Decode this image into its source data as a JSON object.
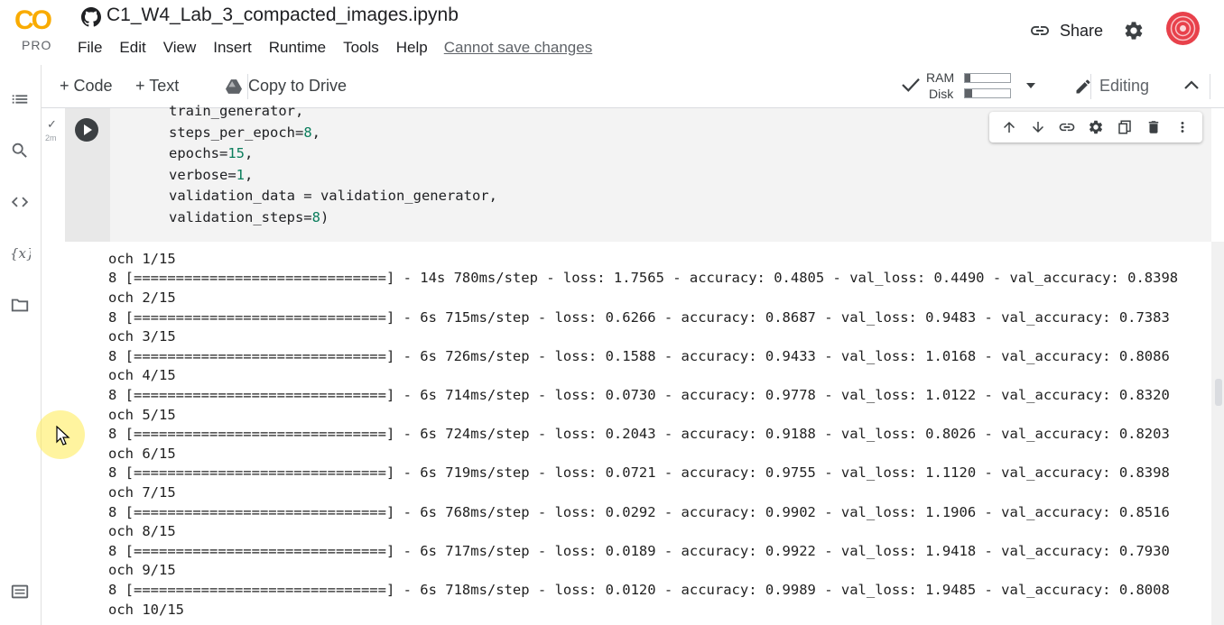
{
  "app": {
    "logo_text": "CO",
    "logo_sub": "PRO",
    "title": "C1_W4_Lab_3_compacted_images.ipynb",
    "menu": [
      "File",
      "Edit",
      "View",
      "Insert",
      "Runtime",
      "Tools",
      "Help"
    ],
    "save_status": "Cannot save changes",
    "share_label": "Share"
  },
  "toolbar": {
    "code_label": "+ Code",
    "text_label": "+ Text",
    "copy_drive_label": "Copy to Drive",
    "ram_label": "RAM",
    "disk_label": "Disk",
    "ram_fraction": 0.12,
    "disk_fraction": 0.15,
    "editing_label": "Editing"
  },
  "cell": {
    "exec_check": "✓",
    "exec_time": "2m",
    "code_lines": [
      {
        "text": "train_generator,"
      },
      {
        "pre": "steps_per_epoch=",
        "num": "8",
        "post": ","
      },
      {
        "pre": "epochs=",
        "num": "15",
        "post": ","
      },
      {
        "pre": "verbose=",
        "num": "1",
        "post": ","
      },
      {
        "text": "validation_data = validation_generator,"
      },
      {
        "pre": "validation_steps=",
        "num": "8",
        "post": ")"
      }
    ]
  },
  "output": {
    "lines": [
      "och 1/15",
      "8 [==============================] - 14s 780ms/step - loss: 1.7565 - accuracy: 0.4805 - val_loss: 0.4490 - val_accuracy: 0.8398",
      "och 2/15",
      "8 [==============================] - 6s 715ms/step - loss: 0.6266 - accuracy: 0.8687 - val_loss: 0.9483 - val_accuracy: 0.7383",
      "och 3/15",
      "8 [==============================] - 6s 726ms/step - loss: 0.1588 - accuracy: 0.9433 - val_loss: 1.0168 - val_accuracy: 0.8086",
      "och 4/15",
      "8 [==============================] - 6s 714ms/step - loss: 0.0730 - accuracy: 0.9778 - val_loss: 1.0122 - val_accuracy: 0.8320",
      "och 5/15",
      "8 [==============================] - 6s 724ms/step - loss: 0.2043 - accuracy: 0.9188 - val_loss: 0.8026 - val_accuracy: 0.8203",
      "och 6/15",
      "8 [==============================] - 6s 719ms/step - loss: 0.0721 - accuracy: 0.9755 - val_loss: 1.1120 - val_accuracy: 0.8398",
      "och 7/15",
      "8 [==============================] - 6s 768ms/step - loss: 0.0292 - accuracy: 0.9902 - val_loss: 1.1906 - val_accuracy: 0.8516",
      "och 8/15",
      "8 [==============================] - 6s 717ms/step - loss: 0.0189 - accuracy: 0.9922 - val_loss: 1.9418 - val_accuracy: 0.7930",
      "och 9/15",
      "8 [==============================] - 6s 718ms/step - loss: 0.0120 - accuracy: 0.9989 - val_loss: 1.9485 - val_accuracy: 0.8008",
      "och 10/15"
    ]
  },
  "colors": {
    "accent": "#f9ab00",
    "avatar": "#e8414b",
    "number": "#0b7d5c"
  }
}
